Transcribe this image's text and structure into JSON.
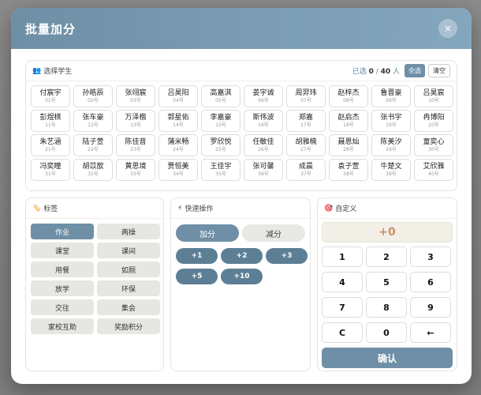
{
  "modal": {
    "title": "批量加分",
    "close_glyph": "×"
  },
  "students_panel": {
    "title": "选择学生",
    "selected_prefix": "已选 ",
    "selected_count": "0",
    "selected_sep": " / ",
    "total": "40",
    "selected_suffix": " 人",
    "select_all": "全选",
    "clear": "清空",
    "students": [
      {
        "name": "付宸宇",
        "no": "01号"
      },
      {
        "name": "孙皓辰",
        "no": "02号"
      },
      {
        "name": "张翊宸",
        "no": "03号"
      },
      {
        "name": "吕昊阳",
        "no": "04号"
      },
      {
        "name": "高嘉淇",
        "no": "05号"
      },
      {
        "name": "姜宇诚",
        "no": "06号"
      },
      {
        "name": "周羿玮",
        "no": "07号"
      },
      {
        "name": "赵梓杰",
        "no": "08号"
      },
      {
        "name": "鲁晋豪",
        "no": "09号"
      },
      {
        "name": "吕昊宸",
        "no": "10号"
      },
      {
        "name": "彭煜棋",
        "no": "11号"
      },
      {
        "name": "张车豪",
        "no": "12号"
      },
      {
        "name": "万泽楷",
        "no": "13号"
      },
      {
        "name": "郭星佑",
        "no": "14号"
      },
      {
        "name": "李嘉豪",
        "no": "15号"
      },
      {
        "name": "斯伟波",
        "no": "16号"
      },
      {
        "name": "郑嘉",
        "no": "17号"
      },
      {
        "name": "赵启杰",
        "no": "18号"
      },
      {
        "name": "张书宇",
        "no": "19号"
      },
      {
        "name": "冉博阳",
        "no": "20号"
      },
      {
        "name": "朱艺涵",
        "no": "21号"
      },
      {
        "name": "陆子萱",
        "no": "22号"
      },
      {
        "name": "陈佳音",
        "no": "23号"
      },
      {
        "name": "蒲米畅",
        "no": "24号"
      },
      {
        "name": "罗欣悦",
        "no": "25号"
      },
      {
        "name": "任敏佳",
        "no": "26号"
      },
      {
        "name": "胡雅楠",
        "no": "27号"
      },
      {
        "name": "聂恩灿",
        "no": "28号"
      },
      {
        "name": "陈美汐",
        "no": "29号"
      },
      {
        "name": "童奕心",
        "no": "30号"
      },
      {
        "name": "冯奕瞳",
        "no": "31号"
      },
      {
        "name": "胡苡歆",
        "no": "32号"
      },
      {
        "name": "黄思境",
        "no": "33号"
      },
      {
        "name": "贾恒美",
        "no": "34号"
      },
      {
        "name": "王佳宇",
        "no": "35号"
      },
      {
        "name": "张可馨",
        "no": "36号"
      },
      {
        "name": "成晨",
        "no": "37号"
      },
      {
        "name": "袁子萱",
        "no": "38号"
      },
      {
        "name": "牛楚文",
        "no": "39号"
      },
      {
        "name": "艾欣雅",
        "no": "40号"
      }
    ]
  },
  "tags_panel": {
    "title": "标签",
    "tags": [
      "作业",
      "两操",
      "课堂",
      "课间",
      "用餐",
      "如厕",
      "放学",
      "环保",
      "交往",
      "集会",
      "家校互助",
      "奖励积分"
    ],
    "active_index": 0
  },
  "quick_panel": {
    "title": "快速操作",
    "add_label": "加分",
    "sub_label": "减分",
    "buttons": [
      "+1",
      "+2",
      "+3",
      "+5",
      "+10"
    ]
  },
  "custom_panel": {
    "title": "自定义",
    "display_value": "+0",
    "keys": [
      "1",
      "2",
      "3",
      "4",
      "5",
      "6",
      "7",
      "8",
      "9",
      "C",
      "0",
      "←"
    ],
    "confirm_label": "确认"
  },
  "colors": {
    "accent": "#6e8fa6",
    "display_text": "#c9906a"
  },
  "icons": {
    "students": "people-icon",
    "tags": "tag-icon",
    "quick": "lightning-icon",
    "custom": "target-icon"
  }
}
